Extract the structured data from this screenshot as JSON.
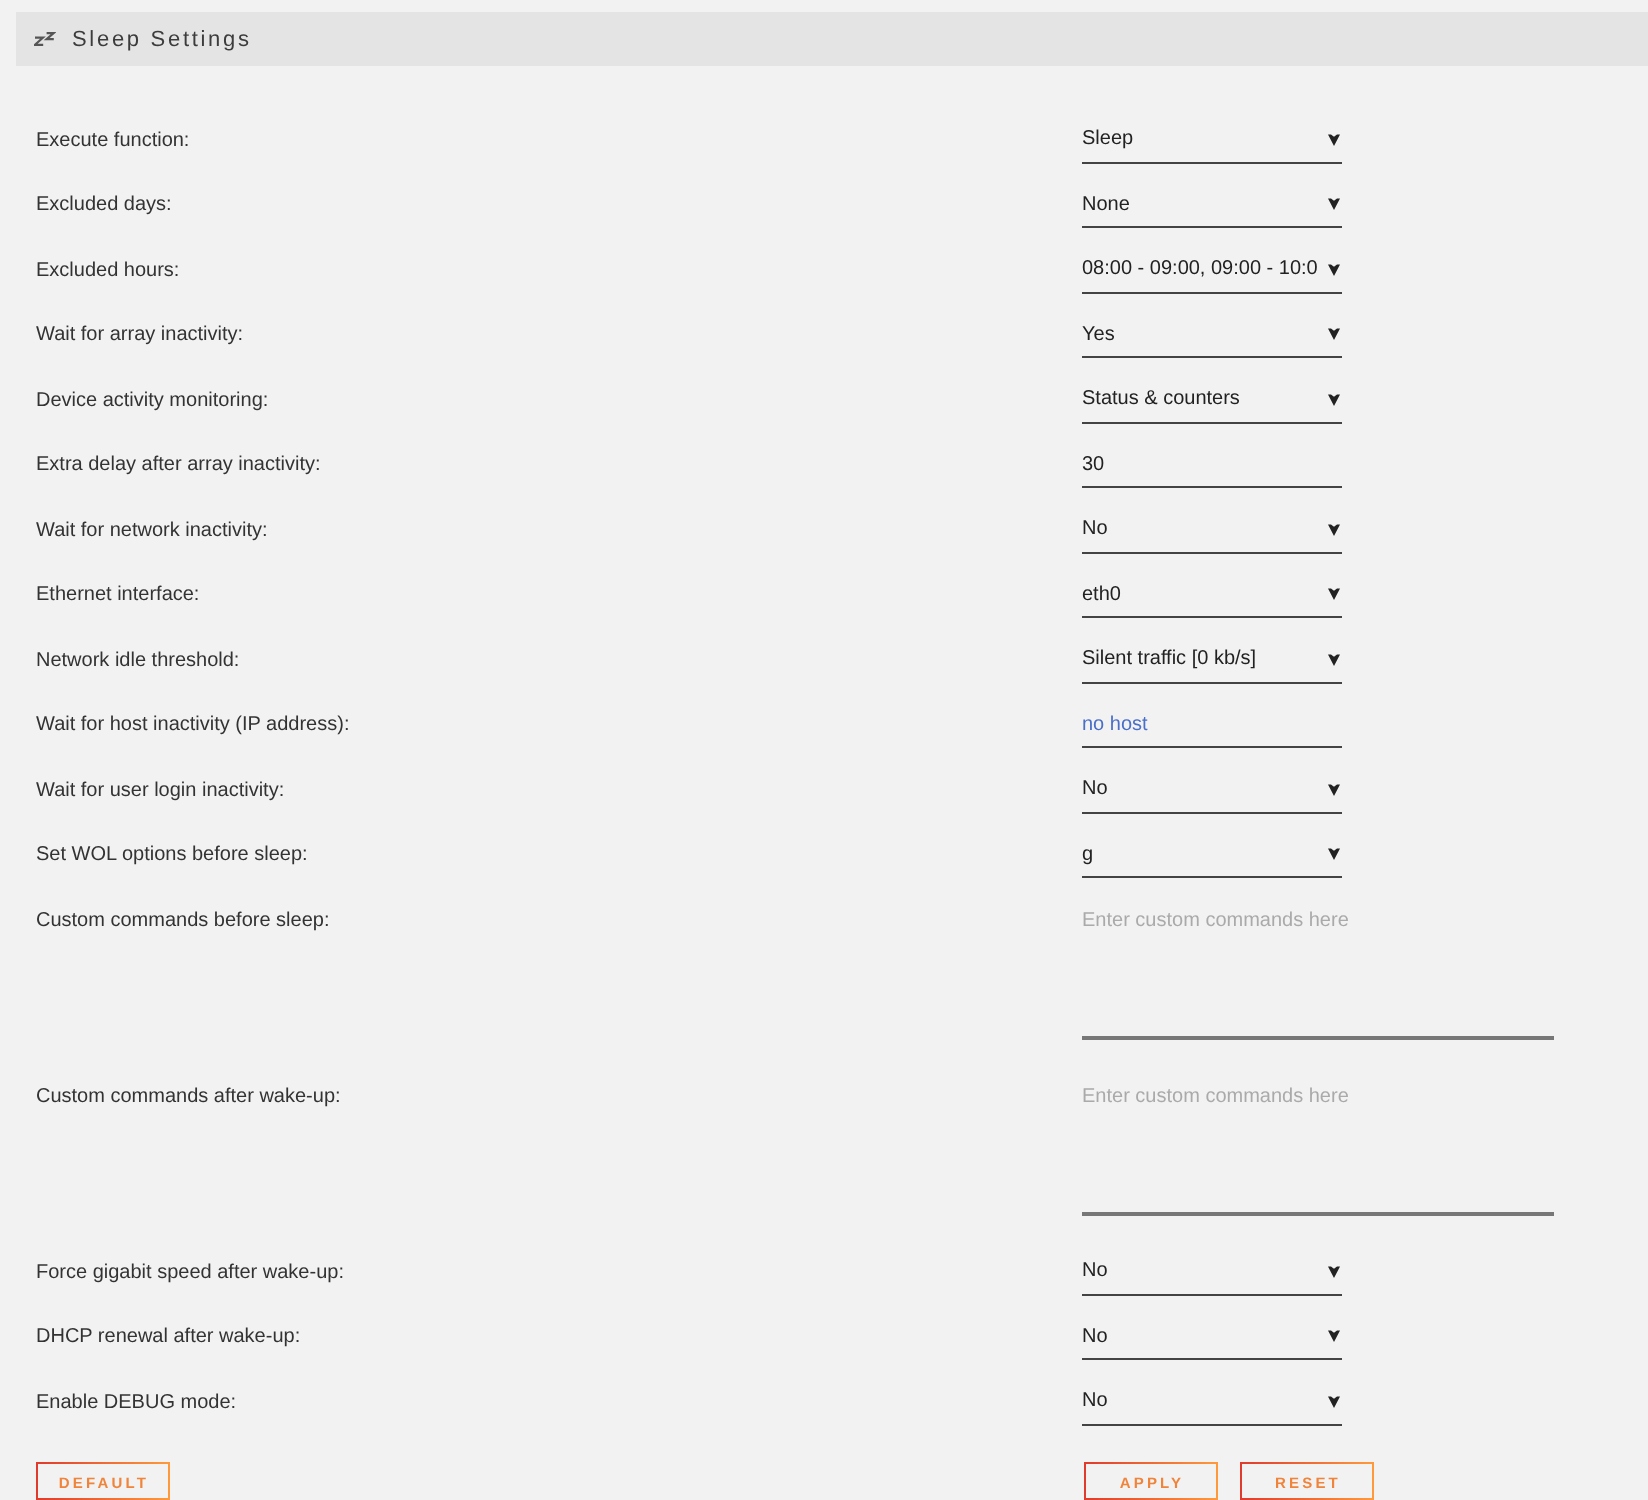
{
  "header": {
    "title": "Sleep Settings"
  },
  "settings": [
    {
      "label": "Execute function:",
      "kind": "select",
      "value": "Sleep"
    },
    {
      "label": "Excluded days:",
      "kind": "select",
      "value": "None"
    },
    {
      "label": "Excluded hours:",
      "kind": "select",
      "value": "08:00 - 09:00, 09:00 - 10:0"
    },
    {
      "label": "Wait for array inactivity:",
      "kind": "select",
      "value": "Yes"
    },
    {
      "label": "Device activity monitoring:",
      "kind": "select",
      "value": "Status & counters"
    },
    {
      "label": "Extra delay after array inactivity:",
      "kind": "input",
      "value": "30"
    },
    {
      "label": "Wait for network inactivity:",
      "kind": "select",
      "value": "No"
    },
    {
      "label": "Ethernet interface:",
      "kind": "select",
      "value": "eth0"
    },
    {
      "label": "Network idle threshold:",
      "kind": "select",
      "value": "Silent traffic [0 kb/s]"
    },
    {
      "label": "Wait for host inactivity (IP address):",
      "kind": "host",
      "value": "no host"
    },
    {
      "label": "Wait for user login inactivity:",
      "kind": "select",
      "value": "No"
    },
    {
      "label": "Set WOL options before sleep:",
      "kind": "select",
      "value": "g"
    },
    {
      "label": "Custom commands before sleep:",
      "kind": "textarea",
      "placeholder": "Enter custom commands here"
    },
    {
      "label": "Custom commands after wake-up:",
      "kind": "textarea",
      "placeholder": "Enter custom commands here"
    },
    {
      "label": "Force gigabit speed after wake-up:",
      "kind": "select",
      "value": "No"
    },
    {
      "label": "DHCP renewal after wake-up:",
      "kind": "select",
      "value": "No"
    },
    {
      "label": "Enable DEBUG mode:",
      "kind": "select",
      "value": "No"
    }
  ],
  "buttons": {
    "left": [
      "DEFAULT"
    ],
    "right": [
      "APPLY",
      "RESET"
    ]
  }
}
